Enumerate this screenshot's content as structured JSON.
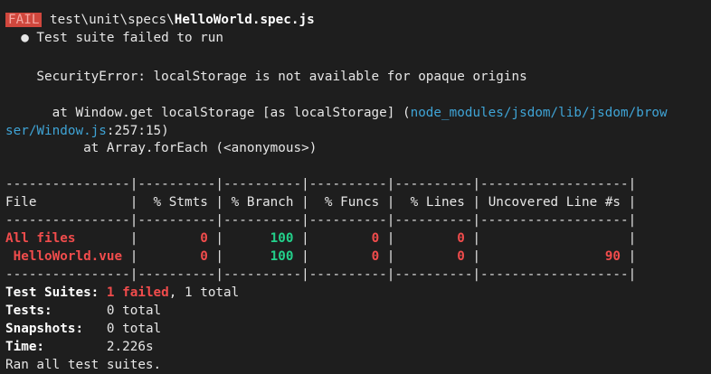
{
  "header": {
    "badge": "FAIL",
    "path_prefix": " test\\unit\\specs\\",
    "path_file": "HelloWorld.spec.js"
  },
  "suite_failed": "  ● Test suite failed to run",
  "error": "    SecurityError: localStorage is not available for opaque origins",
  "stack": {
    "line1_prefix": "      at Window.get localStorage [as localStorage] (",
    "line1_link": "node_modules/jsdom/lib/jsdom/brow",
    "line2_link": "ser/Window.js",
    "line2_suffix": ":257:15)",
    "line3": "          at Array.forEach (<anonymous>)"
  },
  "coverage": {
    "separator": "----------------|----------|----------|----------|----------|-------------------|",
    "headers": [
      "File",
      "% Stmts",
      "% Branch",
      "% Funcs",
      "% Lines",
      "Uncovered Line #s"
    ],
    "rows": [
      {
        "file": "All files",
        "stmts": "0",
        "branch": "100",
        "funcs": "0",
        "lines": "0",
        "uncovered": ""
      },
      {
        "file": " HelloWorld.vue",
        "stmts": "0",
        "branch": "100",
        "funcs": "0",
        "lines": "0",
        "uncovered": "90"
      }
    ]
  },
  "summary": {
    "suites_label": "Test Suites: ",
    "suites_failed": "1 failed",
    "suites_rest": ", 1 total",
    "tests_label": "Tests:       ",
    "tests_value": "0 total",
    "snapshots_label": "Snapshots:   ",
    "snapshots_value": "0 total",
    "time_label": "Time:        ",
    "time_value": "2.226s",
    "footer": "Ran all test suites."
  },
  "colors": {
    "background": "#1e1e1e",
    "fail_badge": "#d0473d",
    "red": "#f14c4c",
    "green": "#23d18b",
    "link": "#3fa4d6"
  }
}
